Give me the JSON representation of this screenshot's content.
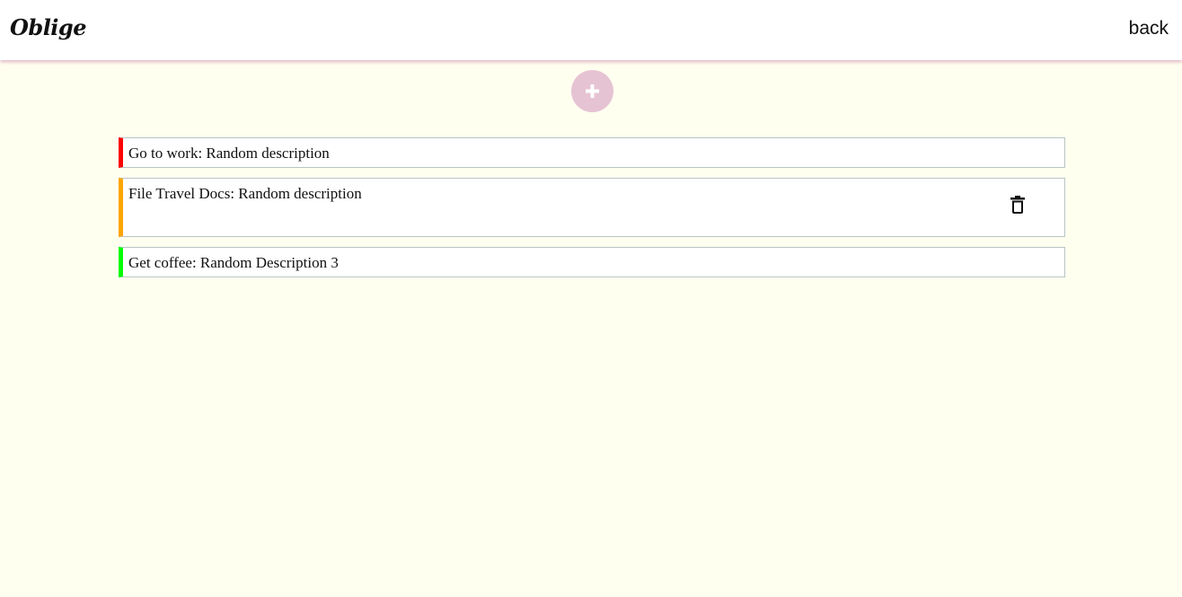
{
  "header": {
    "logo_text": "Oblige",
    "back_label": "back"
  },
  "add_button": {
    "icon": "plus-icon",
    "color": "#e6c3d3"
  },
  "tasks": [
    {
      "text": "Go to work: Random description",
      "priority_color": "#ff0000"
    },
    {
      "text": "File Travel Docs: Random description",
      "priority_color": "#ffa500",
      "action_icon": "trash-icon"
    },
    {
      "text": "Get coffee: Random Description 3",
      "priority_color": "#00ff00"
    }
  ],
  "colors": {
    "page_background": "#fffff0",
    "header_shadow": "#d6a0b9",
    "card_border": "#b8c4c6"
  }
}
